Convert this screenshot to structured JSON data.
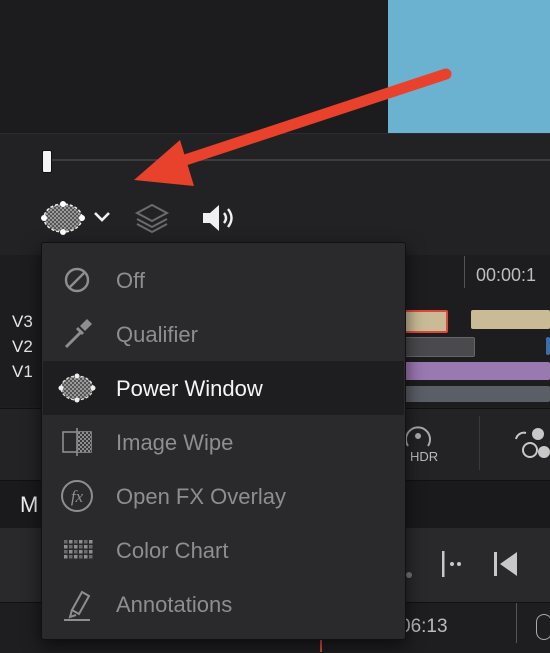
{
  "viewer": {
    "frame_color": "#6bb1d0"
  },
  "toolbar": {
    "window_mode_icon": "power-window-icon",
    "dropdown_icon": "chevron-down-icon",
    "layers_icon": "layers-icon",
    "audio_icon": "speaker-icon"
  },
  "timeline": {
    "timecode": "00:00:1",
    "tracks": [
      {
        "label": "V3"
      },
      {
        "label": "V2"
      },
      {
        "label": "V1"
      }
    ]
  },
  "nodes_bar": {
    "hdr_label": "HDR"
  },
  "m_bar": {
    "label": "M"
  },
  "bottom_ruler": {
    "timecode": "06:13"
  },
  "menu": {
    "items": [
      {
        "label": "Off",
        "icon": "off-icon",
        "selected": false
      },
      {
        "label": "Qualifier",
        "icon": "eyedropper-icon",
        "selected": false
      },
      {
        "label": "Power Window",
        "icon": "power-window-icon",
        "selected": true
      },
      {
        "label": "Image Wipe",
        "icon": "image-wipe-icon",
        "selected": false
      },
      {
        "label": "Open FX Overlay",
        "icon": "fx-icon",
        "selected": false
      },
      {
        "label": "Color Chart",
        "icon": "color-chart-icon",
        "selected": false
      },
      {
        "label": "Annotations",
        "icon": "marker-icon",
        "selected": false
      }
    ]
  },
  "annotation": {
    "arrow_color": "#e8412c"
  }
}
